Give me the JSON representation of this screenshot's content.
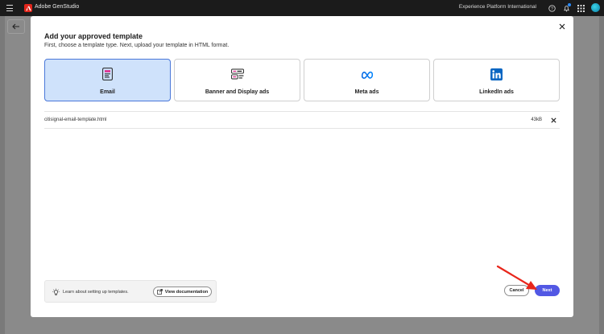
{
  "topbar": {
    "app_name": "Adobe GenStudio",
    "org_name": "Experience Platform International"
  },
  "modal": {
    "title": "Add your approved template",
    "subtitle": "First, choose a template type. Next, upload your template in HTML format.",
    "template_types": [
      {
        "label": "Email",
        "icon": "email-template-icon",
        "selected": true
      },
      {
        "label": "Banner and Display ads",
        "icon": "banner-display-icon",
        "selected": false
      },
      {
        "label": "Meta ads",
        "icon": "meta-logo-icon",
        "selected": false
      },
      {
        "label": "LinkedIn ads",
        "icon": "linkedin-logo-icon",
        "selected": false
      }
    ],
    "file": {
      "name": "citisignal-email-template.html",
      "size": "43kB"
    },
    "help": {
      "text": "Learn about setting up templates.",
      "doc_button": "View documentation"
    },
    "actions": {
      "cancel": "Cancel",
      "next": "Next"
    }
  },
  "colors": {
    "accent": "#5258e4",
    "selected_card_bg": "#cfe2fb",
    "annotation_arrow": "#e8261b"
  }
}
